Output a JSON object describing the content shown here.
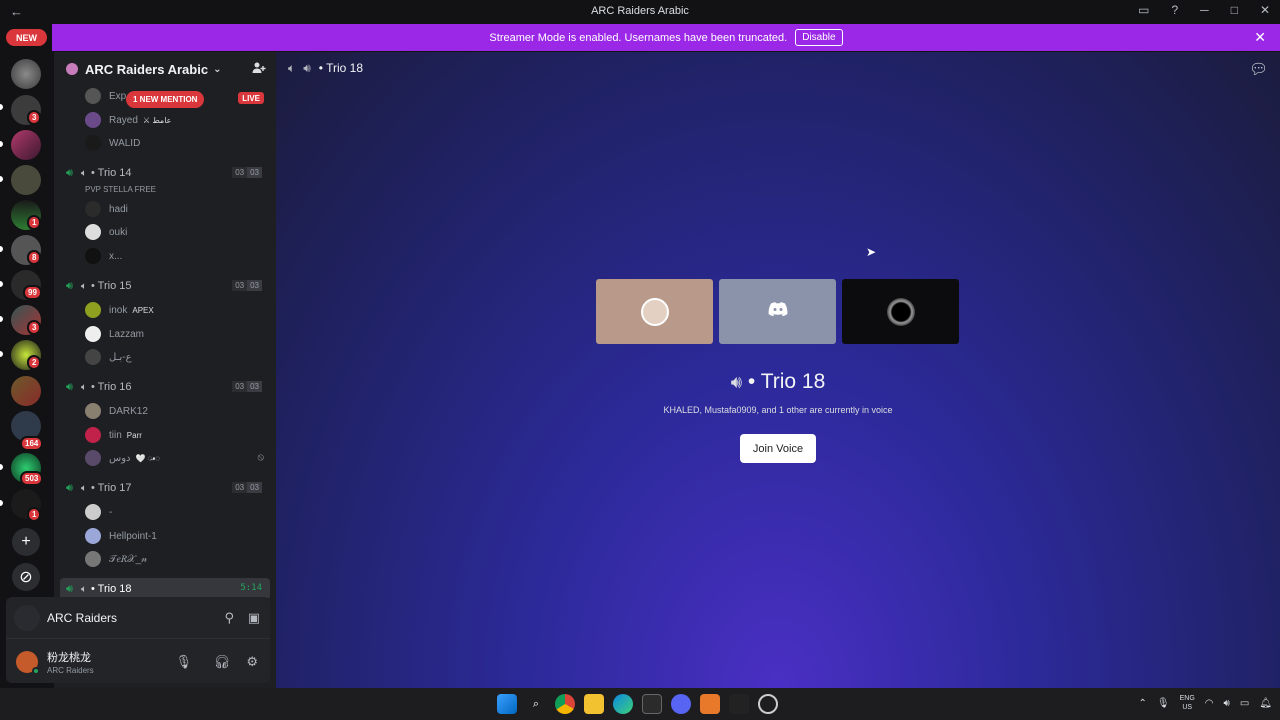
{
  "window": {
    "title": "ARC Raiders Arabic",
    "nav_back": "←",
    "controls": [
      "▭",
      "?",
      "─",
      "□",
      "✕"
    ]
  },
  "banner": {
    "text": "Streamer Mode is enabled. Usernames have been truncated.",
    "disable_label": "Disable",
    "close": "✕",
    "color": "#9b28e6"
  },
  "rail": {
    "new_label": "NEW",
    "badges": [
      "3",
      "1",
      "8",
      "99",
      "3",
      "2",
      "164",
      "503",
      "1"
    ],
    "add_icon": "+",
    "explore_icon": "⊘"
  },
  "server": {
    "name": "ARC Raiders Arabic",
    "chevron": "⌄"
  },
  "sidebar": {
    "mention_pill": "1 NEW MENTION",
    "live_pill": "LIVE",
    "top_members": [
      {
        "name": "Exp",
        "tag": ""
      },
      {
        "name": "Rayed",
        "tag": "⚔ عامط"
      },
      {
        "name": "WALID",
        "tag": ""
      }
    ],
    "channels": [
      {
        "name": "• Trio 14",
        "subtitle": "PVP STELLA FREE",
        "count_a": "03",
        "count_b": "03",
        "members": [
          {
            "name": "hadi",
            "tag": ""
          },
          {
            "name": "ouki",
            "tag": ""
          },
          {
            "name": "x...",
            "tag": ""
          }
        ]
      },
      {
        "name": "• Trio 15",
        "subtitle": "",
        "count_a": "03",
        "count_b": "03",
        "members": [
          {
            "name": "inok",
            "tag": "APEX"
          },
          {
            "name": "Lazzam",
            "tag": ""
          },
          {
            "name": "ع-بـل",
            "tag": ""
          }
        ]
      },
      {
        "name": "• Trio 16",
        "subtitle": "",
        "count_a": "03",
        "count_b": "03",
        "members": [
          {
            "name": "DARK12",
            "tag": ""
          },
          {
            "name": "tiin",
            "tag": "Parr"
          },
          {
            "name": "دوس",
            "tag": "🤍 ◌̶•◌"
          }
        ]
      },
      {
        "name": "• Trio 17",
        "subtitle": "",
        "count_a": "03",
        "count_b": "03",
        "members": [
          {
            "name": "-",
            "tag": ""
          },
          {
            "name": "Hellpoint-1",
            "tag": ""
          },
          {
            "name": "𝒯𝑒𝑅𝒳_𝓃",
            "tag": ""
          }
        ]
      }
    ],
    "selected_channel": {
      "name": "• Trio 18",
      "timer": "5:14"
    }
  },
  "user_panel": {
    "server_name": "ARC Raiders",
    "username": "粉龙桃龙",
    "status": "ARC Raiders",
    "icons": [
      "mic-icon",
      "headphones-icon",
      "gear-icon"
    ]
  },
  "main": {
    "header_channel": "• Trio 18",
    "voice_title": "• Trio 18",
    "voice_subtitle": "KHALED, Mustafa0909, and 1 other are currently in voice",
    "join_label": "Join Voice",
    "tile_colors": [
      "#b8998a",
      "#8a93aa",
      "#0c0c0e"
    ]
  },
  "taskbar": {
    "lang_top": "ENG",
    "lang_bottom": "US"
  }
}
